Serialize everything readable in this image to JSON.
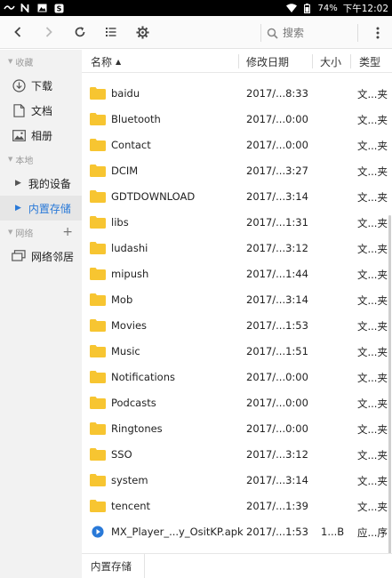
{
  "status_bar": {
    "left_icons": [
      "signal-icon",
      "n-icon",
      "image-icon",
      "app-icon"
    ],
    "battery": "74%",
    "time": "下午12:02"
  },
  "toolbar": {
    "search_placeholder": "搜索"
  },
  "sidebar": {
    "sections": [
      {
        "label": "收藏",
        "items": [
          {
            "label": "下载",
            "icon": "download-icon"
          },
          {
            "label": "文档",
            "icon": "document-icon"
          },
          {
            "label": "相册",
            "icon": "photo-icon"
          }
        ]
      },
      {
        "label": "本地",
        "items": [
          {
            "label": "我的设备",
            "icon": "expand-triangle-icon"
          },
          {
            "label": "内置存储",
            "icon": "expand-triangle-icon",
            "active": true
          }
        ]
      },
      {
        "label": "网络",
        "items": [
          {
            "label": "网络邻居",
            "icon": "network-icon"
          }
        ]
      }
    ]
  },
  "columns": {
    "name": "名称",
    "date": "修改日期",
    "size": "大小",
    "type": "类型"
  },
  "files": [
    {
      "name": "baidu",
      "date": "2017/...8:33",
      "size": "",
      "type": "文...夹",
      "kind": "folder"
    },
    {
      "name": "Bluetooth",
      "date": "2017/...0:00",
      "size": "",
      "type": "文...夹",
      "kind": "folder"
    },
    {
      "name": "Contact",
      "date": "2017/...0:00",
      "size": "",
      "type": "文...夹",
      "kind": "folder"
    },
    {
      "name": "DCIM",
      "date": "2017/...3:27",
      "size": "",
      "type": "文...夹",
      "kind": "folder"
    },
    {
      "name": "GDTDOWNLOAD",
      "date": "2017/...3:14",
      "size": "",
      "type": "文...夹",
      "kind": "folder"
    },
    {
      "name": "libs",
      "date": "2017/...1:31",
      "size": "",
      "type": "文...夹",
      "kind": "folder"
    },
    {
      "name": "ludashi",
      "date": "2017/...3:12",
      "size": "",
      "type": "文...夹",
      "kind": "folder"
    },
    {
      "name": "mipush",
      "date": "2017/...1:44",
      "size": "",
      "type": "文...夹",
      "kind": "folder"
    },
    {
      "name": "Mob",
      "date": "2017/...3:14",
      "size": "",
      "type": "文...夹",
      "kind": "folder"
    },
    {
      "name": "Movies",
      "date": "2017/...1:53",
      "size": "",
      "type": "文...夹",
      "kind": "folder"
    },
    {
      "name": "Music",
      "date": "2017/...1:51",
      "size": "",
      "type": "文...夹",
      "kind": "folder"
    },
    {
      "name": "Notifications",
      "date": "2017/...0:00",
      "size": "",
      "type": "文...夹",
      "kind": "folder"
    },
    {
      "name": "Podcasts",
      "date": "2017/...0:00",
      "size": "",
      "type": "文...夹",
      "kind": "folder"
    },
    {
      "name": "Ringtones",
      "date": "2017/...0:00",
      "size": "",
      "type": "文...夹",
      "kind": "folder"
    },
    {
      "name": "SSO",
      "date": "2017/...3:12",
      "size": "",
      "type": "文...夹",
      "kind": "folder"
    },
    {
      "name": "system",
      "date": "2017/...3:14",
      "size": "",
      "type": "文...夹",
      "kind": "folder"
    },
    {
      "name": "tencent",
      "date": "2017/...1:39",
      "size": "",
      "type": "文...夹",
      "kind": "folder"
    },
    {
      "name": "MX_Player_...y_OsitKP.apk",
      "date": "2017/...1:53",
      "size": "1...B",
      "type": "应...序",
      "kind": "apk"
    }
  ],
  "footer": {
    "breadcrumb": "内置存储"
  },
  "colors": {
    "accent": "#2979d8",
    "folder": "#f7c531",
    "sidebar_bg": "#f2f2f2"
  }
}
